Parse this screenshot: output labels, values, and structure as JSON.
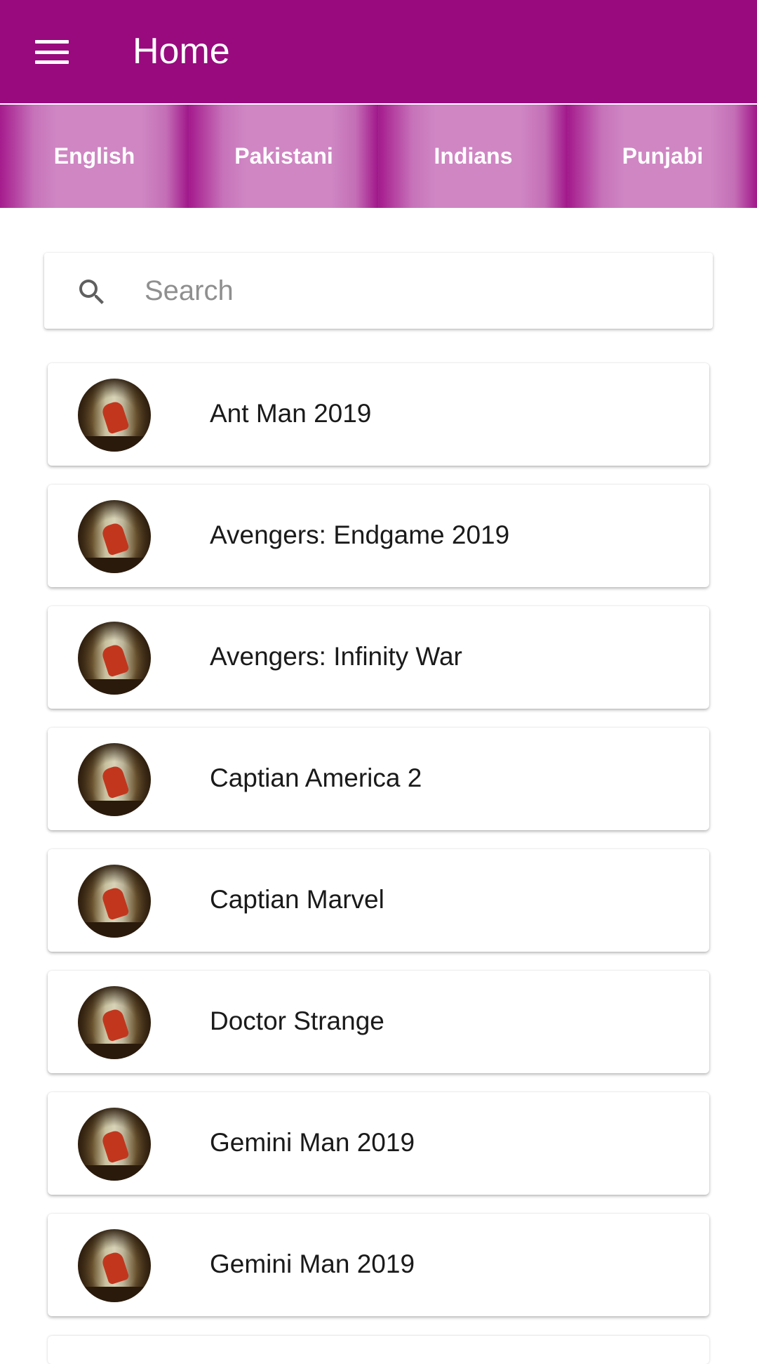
{
  "header": {
    "title": "Home",
    "background": "#980a7e",
    "menu_icon": "hamburger-menu-icon"
  },
  "tabs": [
    {
      "label": "English"
    },
    {
      "label": "Pakistani"
    },
    {
      "label": "Indians"
    },
    {
      "label": "Punjabi"
    }
  ],
  "search": {
    "placeholder": "Search",
    "value": "",
    "icon": "search-icon"
  },
  "movies": [
    {
      "title": "Ant Man 2019"
    },
    {
      "title": "Avengers: Endgame 2019"
    },
    {
      "title": "Avengers: Infinity War"
    },
    {
      "title": "Captian America 2"
    },
    {
      "title": "Captian Marvel"
    },
    {
      "title": "Doctor Strange"
    },
    {
      "title": "Gemini Man 2019"
    },
    {
      "title": "Gemini Man 2019"
    }
  ]
}
